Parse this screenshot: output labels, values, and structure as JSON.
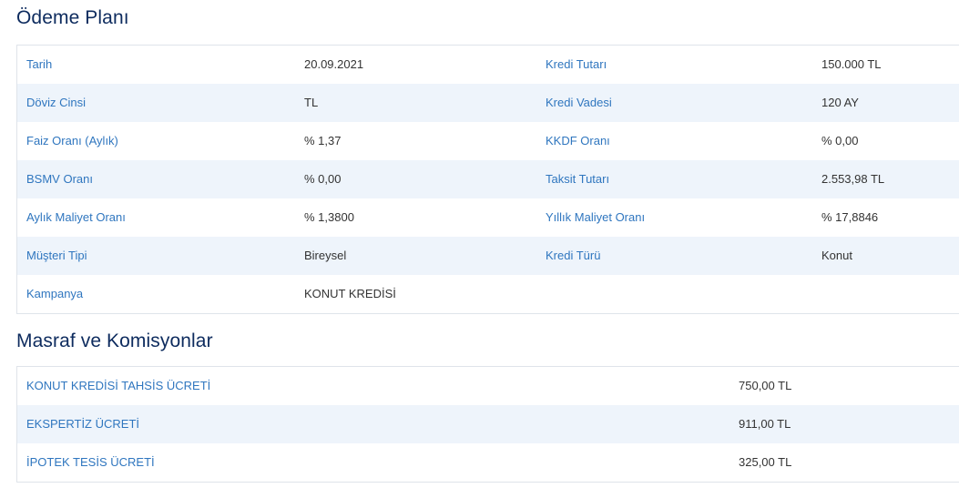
{
  "payment_plan": {
    "title": "Ödeme Planı",
    "rows": [
      {
        "label1": "Tarih",
        "value1": "20.09.2021",
        "label2": "Kredi Tutarı",
        "value2": "150.000 TL"
      },
      {
        "label1": "Döviz Cinsi",
        "value1": "TL",
        "label2": "Kredi Vadesi",
        "value2": "120 AY"
      },
      {
        "label1": "Faiz Oranı (Aylık)",
        "value1": "% 1,37",
        "label2": "KKDF Oranı",
        "value2": "% 0,00"
      },
      {
        "label1": "BSMV Oranı",
        "value1": "% 0,00",
        "label2": "Taksit Tutarı",
        "value2": "2.553,98 TL"
      },
      {
        "label1": "Aylık Maliyet Oranı",
        "value1": "% 1,3800",
        "label2": "Yıllık Maliyet Oranı",
        "value2": "% 17,8846"
      },
      {
        "label1": "Müşteri Tipi",
        "value1": "Bireysel",
        "label2": "Kredi Türü",
        "value2": "Konut"
      },
      {
        "label1": "Kampanya",
        "value1": "KONUT KREDİSİ",
        "label2": "",
        "value2": ""
      }
    ]
  },
  "fees": {
    "title": "Masraf ve Komisyonlar",
    "rows": [
      {
        "label": "KONUT KREDİSİ TAHSİS ÜCRETİ",
        "value": "750,00 TL"
      },
      {
        "label": "EKSPERTİZ ÜCRETİ",
        "value": "911,00 TL"
      },
      {
        "label": "İPOTEK TESİS ÜCRETİ",
        "value": "325,00 TL"
      }
    ]
  },
  "colors": {
    "title": "#0d2b5e",
    "label": "#2f76bf",
    "value": "#333333",
    "alt_row": "#eef4fb",
    "border": "#dfe4ea"
  }
}
